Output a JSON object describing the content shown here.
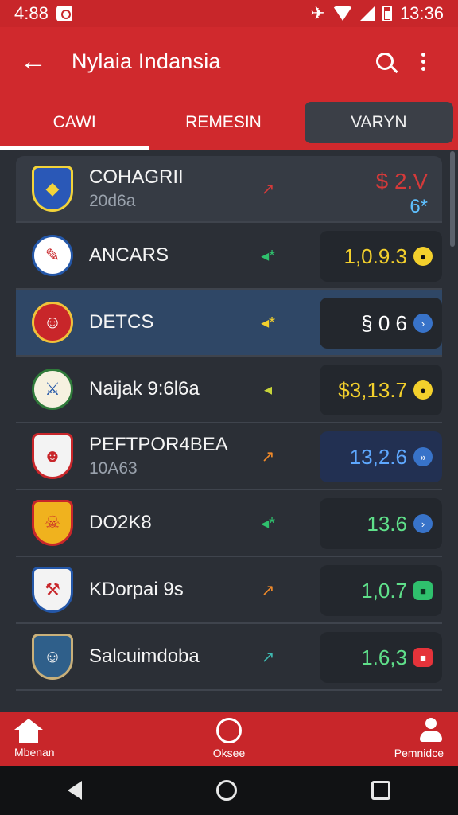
{
  "status_bar": {
    "time": "4:88",
    "clock_right": "13:36"
  },
  "app_bar": {
    "title": "Nylaia Indansia",
    "back_icon": "arrow-left-icon",
    "search_icon": "search-icon",
    "more_icon": "more-vert-icon"
  },
  "tabs": [
    {
      "label": "CAWI",
      "active": true
    },
    {
      "label": "REMESIN",
      "active": false
    },
    {
      "label": "VARYN",
      "active": false
    }
  ],
  "rows": [
    {
      "name": "COHAGRII",
      "sub": "20d6a",
      "trend": "↗",
      "value": "$ 2.V",
      "value_sub": "6*",
      "badge": ""
    },
    {
      "name": "ANCARS",
      "sub": "",
      "trend": "◂*",
      "value": "1,0.9.3",
      "badge": "●"
    },
    {
      "name": "DETCS",
      "sub": "",
      "trend": "◂*",
      "value": "§ 0 6",
      "badge": "›"
    },
    {
      "name": "Naijak 9:6l6a",
      "sub": "",
      "trend": "◂",
      "value": "$3,13.7",
      "badge": "●"
    },
    {
      "name": "PEFTPOR4BEA",
      "sub": "10A63",
      "trend": "↗",
      "value": "13,2.6",
      "badge": "»"
    },
    {
      "name": "DO2K8",
      "sub": "",
      "trend": "◂*",
      "value": "13.6",
      "badge": "›"
    },
    {
      "name": "KDorpai 9s",
      "sub": "",
      "trend": "↗",
      "value": "1,0.7",
      "badge": "■"
    },
    {
      "name": "Salcuimdoba",
      "sub": "",
      "trend": "↗",
      "value": "1.6,3",
      "badge": "■"
    }
  ],
  "bottom_nav": [
    {
      "label": "Mbenan",
      "icon": "home-icon"
    },
    {
      "label": "Oksee",
      "icon": "circle-icon"
    },
    {
      "label": "Pemnidce",
      "icon": "person-icon"
    }
  ],
  "colors": {
    "primary": "#d0292d",
    "background": "#2b2f36",
    "highlight_row": "#2f4766"
  }
}
